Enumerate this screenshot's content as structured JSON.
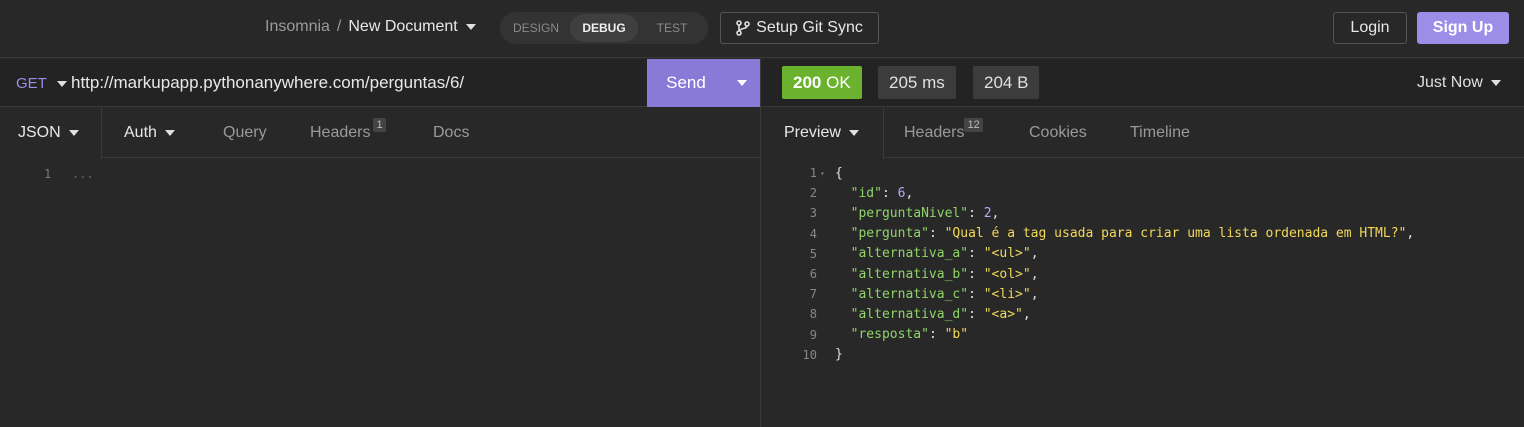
{
  "header": {
    "app_name": "Insomnia",
    "separator": "/",
    "document_name": "New Document",
    "modes": [
      "DESIGN",
      "DEBUG",
      "TEST"
    ],
    "active_mode": "DEBUG",
    "git_sync_label": "Setup Git Sync",
    "login_label": "Login",
    "signup_label": "Sign Up"
  },
  "request": {
    "method": "GET",
    "url": "http://markupapp.pythonanywhere.com/perguntas/6/",
    "send_label": "Send",
    "body_type": "JSON",
    "tabs": {
      "auth": "Auth",
      "query": "Query",
      "headers": "Headers",
      "headers_count": "1",
      "docs": "Docs"
    },
    "editor": {
      "line_number": "1",
      "placeholder": "..."
    }
  },
  "response": {
    "status_code": "200",
    "status_text": "OK",
    "time": "205 ms",
    "size": "204 B",
    "timestamp": "Just Now",
    "view": "Preview",
    "tabs": {
      "headers": "Headers",
      "headers_count": "12",
      "cookies": "Cookies",
      "timeline": "Timeline"
    },
    "body_lines": [
      {
        "n": "1",
        "k": "",
        "v": "",
        "raw": "{"
      },
      {
        "n": "2",
        "k": "\"id\"",
        "v": "6",
        "t": "n"
      },
      {
        "n": "3",
        "k": "\"perguntaNivel\"",
        "v": "2",
        "t": "n"
      },
      {
        "n": "4",
        "k": "\"pergunta\"",
        "v": "\"Qual é a tag usada para criar uma lista ordenada em HTML?\"",
        "t": "s"
      },
      {
        "n": "5",
        "k": "\"alternativa_a\"",
        "v": "\"<ul>\"",
        "t": "s"
      },
      {
        "n": "6",
        "k": "\"alternativa_b\"",
        "v": "\"<ol>\"",
        "t": "s"
      },
      {
        "n": "7",
        "k": "\"alternativa_c\"",
        "v": "\"<li>\"",
        "t": "s"
      },
      {
        "n": "8",
        "k": "\"alternativa_d\"",
        "v": "\"<a>\"",
        "t": "s"
      },
      {
        "n": "9",
        "k": "\"resposta\"",
        "v": "\"b\"",
        "t": "s",
        "last": true
      },
      {
        "n": "10",
        "k": "",
        "v": "",
        "raw": "}"
      }
    ]
  },
  "colors": {
    "accent": "#9c8de8",
    "send": "#8a7ad8",
    "status_ok": "#6bb32e",
    "json_key": "#8fd46a",
    "json_number": "#b8a6ff",
    "json_string": "#f2d85a"
  }
}
